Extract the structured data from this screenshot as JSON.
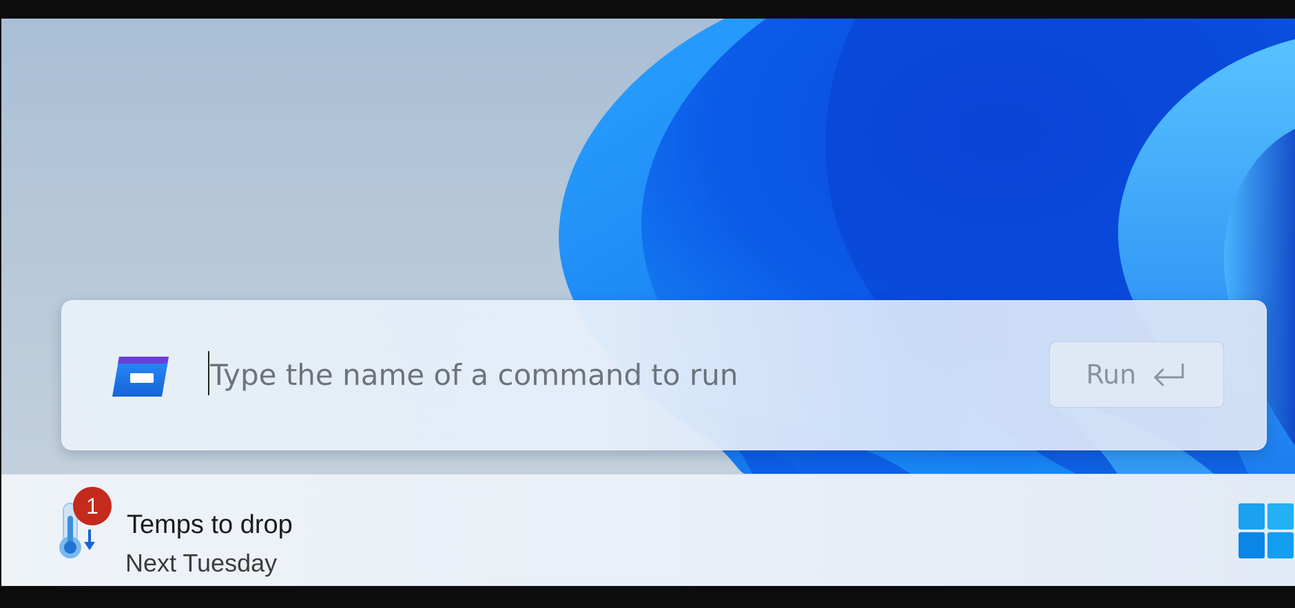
{
  "run_dialog": {
    "placeholder": "Type the name of a command to run",
    "run_label": "Run",
    "app_icon": "run-dialog-icon",
    "enter_icon": "enter-return-icon"
  },
  "taskbar": {
    "weather": {
      "icon": "thermometer-dropping-icon",
      "badge_count": "1",
      "title": "Temps to drop",
      "subtitle": "Next Tuesday"
    },
    "start_icon": "windows-start-icon"
  },
  "colors": {
    "accent": "#0067c0",
    "badge": "#c42b1c",
    "start_blue": "#1aa1f0"
  }
}
